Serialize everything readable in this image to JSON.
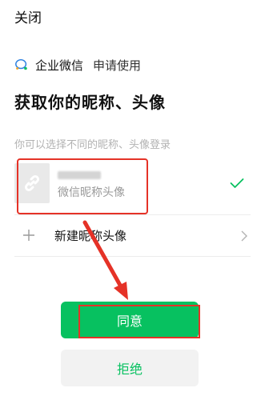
{
  "header": {
    "close_label": "关闭"
  },
  "app": {
    "name": "企业微信",
    "action": "申请使用",
    "icon": "wecom-icon"
  },
  "title": "获取你的昵称、头像",
  "hint": "你可以选择不同的昵称、头像登录",
  "options": [
    {
      "sub_label": "微信昵称头像",
      "selected": true,
      "avatar_icon": "link-icon"
    }
  ],
  "new_option": {
    "label": "新建昵称头像"
  },
  "buttons": {
    "agree": "同意",
    "reject": "拒绝"
  },
  "colors": {
    "brand_green": "#07c160",
    "annotation_red": "#e53227",
    "hint_gray": "#b2b2b2"
  }
}
